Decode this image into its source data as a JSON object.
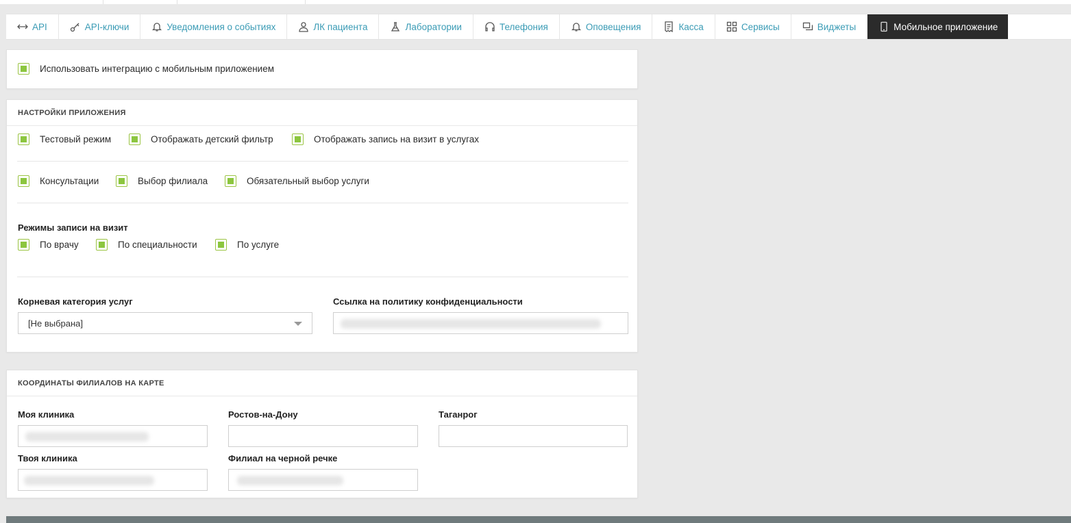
{
  "tabs": [
    {
      "label": "API",
      "icon": "arrows-horizontal-icon"
    },
    {
      "label": "API-ключи",
      "icon": "key-icon"
    },
    {
      "label": "Уведомления о событиях",
      "icon": "bell-icon"
    },
    {
      "label": "ЛК пациента",
      "icon": "user-icon"
    },
    {
      "label": "Лаборатории",
      "icon": "flask-icon"
    },
    {
      "label": "Телефония",
      "icon": "headphones-icon"
    },
    {
      "label": "Оповещения",
      "icon": "bell-icon"
    },
    {
      "label": "Касса",
      "icon": "receipt-icon"
    },
    {
      "label": "Сервисы",
      "icon": "grid-icon"
    },
    {
      "label": "Виджеты",
      "icon": "windows-icon"
    },
    {
      "label": "Мобильное приложение",
      "icon": "phone-icon",
      "active": true
    }
  ],
  "integration": {
    "use_integration": "Использовать интеграцию с мобильным приложением"
  },
  "app_settings": {
    "title": "НАСТРОЙКИ ПРИЛОЖЕНИЯ",
    "row1": [
      "Тестовый режим",
      "Отображать детский фильтр",
      "Отображать запись на визит в услугах"
    ],
    "row2": [
      "Консультации",
      "Выбор филиала",
      "Обязательный выбор услуги"
    ],
    "visit_modes_label": "Режимы записи на визит",
    "visit_modes": [
      "По врачу",
      "По специальности",
      "По услуге"
    ],
    "root_category_label": "Корневая категория услуг",
    "root_category_value": "[Не выбрана]",
    "privacy_label": "Ссылка на политику конфиденциальности"
  },
  "branches": {
    "title": "КООРДИНАТЫ ФИЛИАЛОВ НА КАРТЕ",
    "items": [
      "Моя клиника",
      "Ростов-на-Дону",
      "Таганрог",
      "Твоя клиника",
      "Филиал на черной речке"
    ]
  },
  "colors": {
    "accent": "#8cc63f",
    "link": "#3a9bb5",
    "active_tab_bg": "#2b2b2b"
  }
}
